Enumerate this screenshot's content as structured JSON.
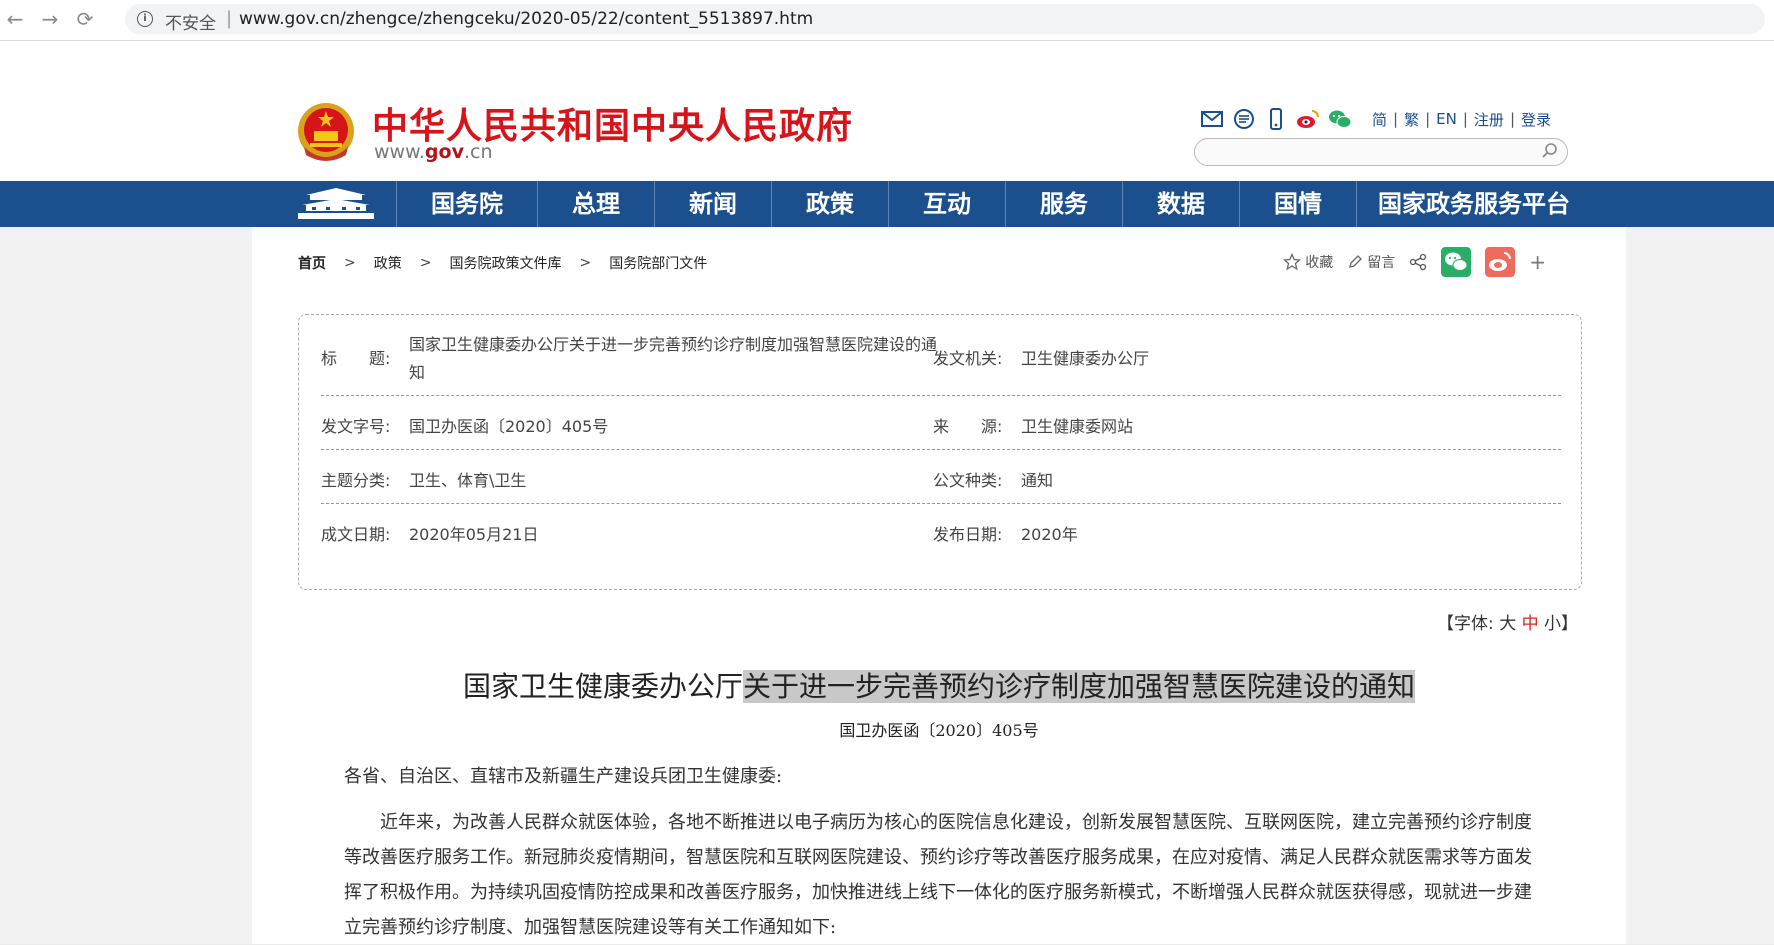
{
  "browser": {
    "security_label": "不安全",
    "url": "www.gov.cn/zhengce/zhengceku/2020-05/22/content_5513897.htm",
    "back_glyph": "←",
    "forward_glyph": "→",
    "reload_glyph": "⟳"
  },
  "header": {
    "site_name": "中华人民共和国中央人民政府",
    "site_url_prefix": "www.",
    "site_url_bold": "gov",
    "site_url_suffix": ".cn",
    "lang_links": [
      "简",
      "繁",
      "EN",
      "注册",
      "登录"
    ],
    "icons": [
      "mail-icon",
      "message-icon",
      "mobile-icon",
      "weibo-icon",
      "wechat-icon"
    ]
  },
  "nav": {
    "items": [
      "国务院",
      "总理",
      "新闻",
      "政策",
      "互动",
      "服务",
      "数据",
      "国情",
      "国家政务服务平台"
    ]
  },
  "breadcrumb": [
    "首页",
    "政策",
    "国务院政策文件库",
    "国务院部门文件"
  ],
  "share": {
    "favorite_label": "收藏",
    "comment_label": "留言",
    "plus": "+"
  },
  "meta": {
    "title_label": "标　　题:",
    "title_value_line1": "国家卫生健康委办公厅关于进一步完善预约诊疗制度加强智慧医院建设的通",
    "title_value_line2": "知",
    "issuer_label": "发文机关:",
    "issuer_value": "卫生健康委办公厅",
    "doc_no_label": "发文字号:",
    "doc_no_value": "国卫办医函〔2020〕405号",
    "source_label": "来　　源:",
    "source_value": "卫生健康委网站",
    "category_label": "主题分类:",
    "category_value": "卫生、体育\\卫生",
    "type_label": "公文种类:",
    "type_value": "通知",
    "written_label": "成文日期:",
    "written_value": "2020年05月21日",
    "publish_label": "发布日期:",
    "publish_value": "2020年"
  },
  "font_size": {
    "open": "【字体:",
    "large": "大",
    "medium": "中",
    "small": "小",
    "close": "】"
  },
  "document": {
    "title_plain": "国家卫生健康委办公厅",
    "title_highlight": "关于进一步完善预约诊疗制度加强智慧医院建设的通知",
    "number": "国卫办医函〔2020〕405号",
    "salutation": "各省、自治区、直辖市及新疆生产建设兵团卫生健康委:",
    "paragraph": "近年来，为改善人民群众就医体验，各地不断推进以电子病历为核心的医院信息化建设，创新发展智慧医院、互联网医院，建立完善预约诊疗制度等改善医疗服务工作。新冠肺炎疫情期间，智慧医院和互联网医院建设、预约诊疗等改善医疗服务成果，在应对疫情、满足人民群众就医需求等方面发挥了积极作用。为持续巩固疫情防控成果和改善医疗服务，加快推进线上线下一体化的医疗服务新模式，不断增强人民群众就医获得感，现就进一步建立完善预约诊疗制度、加强智慧医院建设等有关工作通知如下:"
  },
  "colors": {
    "brand_red": "#d7141a",
    "nav_blue": "#1b4f8d",
    "link_blue": "#1a4f8f"
  }
}
